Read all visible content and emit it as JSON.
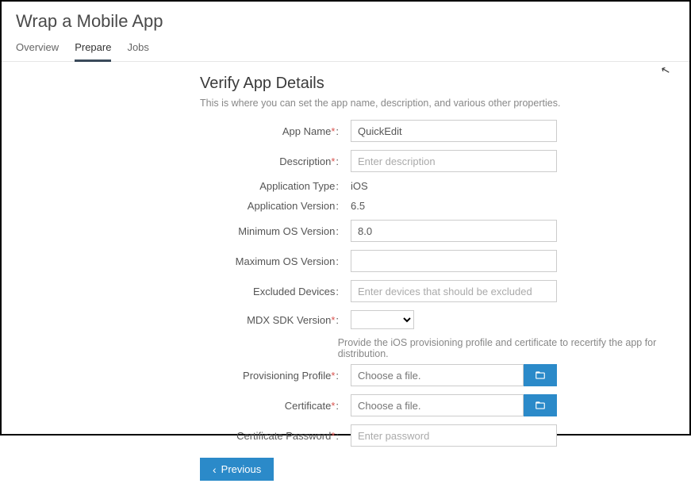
{
  "page_title": "Wrap a Mobile App",
  "tabs": {
    "overview": "Overview",
    "prepare": "Prepare",
    "jobs": "Jobs"
  },
  "section": {
    "title": "Verify App Details",
    "desc": "This is where you can set the app name, description, and various other properties."
  },
  "labels": {
    "app_name": "App Name",
    "description": "Description",
    "app_type": "Application Type",
    "app_version": "Application Version",
    "min_os": "Minimum OS Version",
    "max_os": "Maximum OS Version",
    "excluded": "Excluded Devices",
    "mdx_sdk": "MDX SDK Version",
    "prov_profile": "Provisioning Profile",
    "certificate": "Certificate",
    "cert_password": "Certificate Password"
  },
  "values": {
    "app_name": "QuickEdit",
    "app_type": "iOS",
    "app_version": "6.5",
    "min_os": "8.0",
    "max_os": "",
    "excluded": "",
    "mdx_sdk": "",
    "cert_password": ""
  },
  "placeholders": {
    "description": "Enter description",
    "excluded": "Enter devices that should be excluded",
    "choose_file": "Choose a file.",
    "cert_password": "Enter password"
  },
  "helper": {
    "provision": "Provide the iOS provisioning profile and certificate to recertify the app for distribution."
  },
  "buttons": {
    "previous": "Previous"
  }
}
